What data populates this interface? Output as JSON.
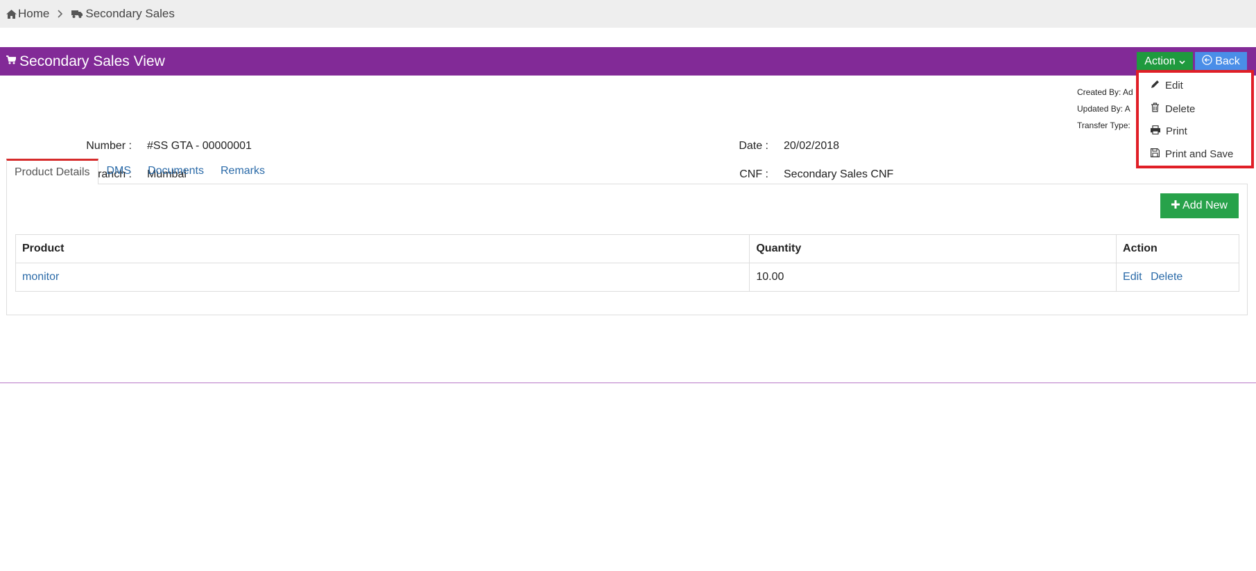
{
  "breadcrumb": {
    "home": "Home",
    "current": "Secondary Sales"
  },
  "header": {
    "title": "Secondary Sales View",
    "action_label": "Action",
    "back_label": "Back"
  },
  "meta": {
    "created_by": "Created By: Ad",
    "updated_by": "Updated By: A",
    "transfer_type": "Transfer Type:"
  },
  "fields": {
    "number_label": "Number :",
    "number_value": "#SS GTA - 00000001",
    "branch_label": "Branch :",
    "branch_value": "Mumbai",
    "date_label": "Date :",
    "date_value": "20/02/2018",
    "cnf_label": "CNF :",
    "cnf_value": "Secondary Sales CNF"
  },
  "tabs": [
    {
      "label": "Product Details"
    },
    {
      "label": "DMS"
    },
    {
      "label": "Documents"
    },
    {
      "label": "Remarks"
    }
  ],
  "add_new_label": "Add New",
  "table": {
    "headers": [
      "Product",
      "Quantity",
      "Action"
    ],
    "rows": [
      {
        "product": "monitor",
        "quantity": "10.00",
        "edit": "Edit",
        "delete": "Delete"
      }
    ]
  },
  "dropdown": {
    "items": [
      {
        "label": "Edit",
        "icon": "pencil-icon"
      },
      {
        "label": "Delete",
        "icon": "trash-icon"
      },
      {
        "label": "Print",
        "icon": "print-icon"
      },
      {
        "label": "Print and Save",
        "icon": "save-icon"
      }
    ]
  },
  "colors": {
    "header_purple": "#822a97",
    "action_green": "#1f9a3e",
    "back_blue": "#4a8ee8",
    "add_green": "#27a24a",
    "highlight_red": "#e01e26",
    "link_blue": "#2a6aa8"
  }
}
